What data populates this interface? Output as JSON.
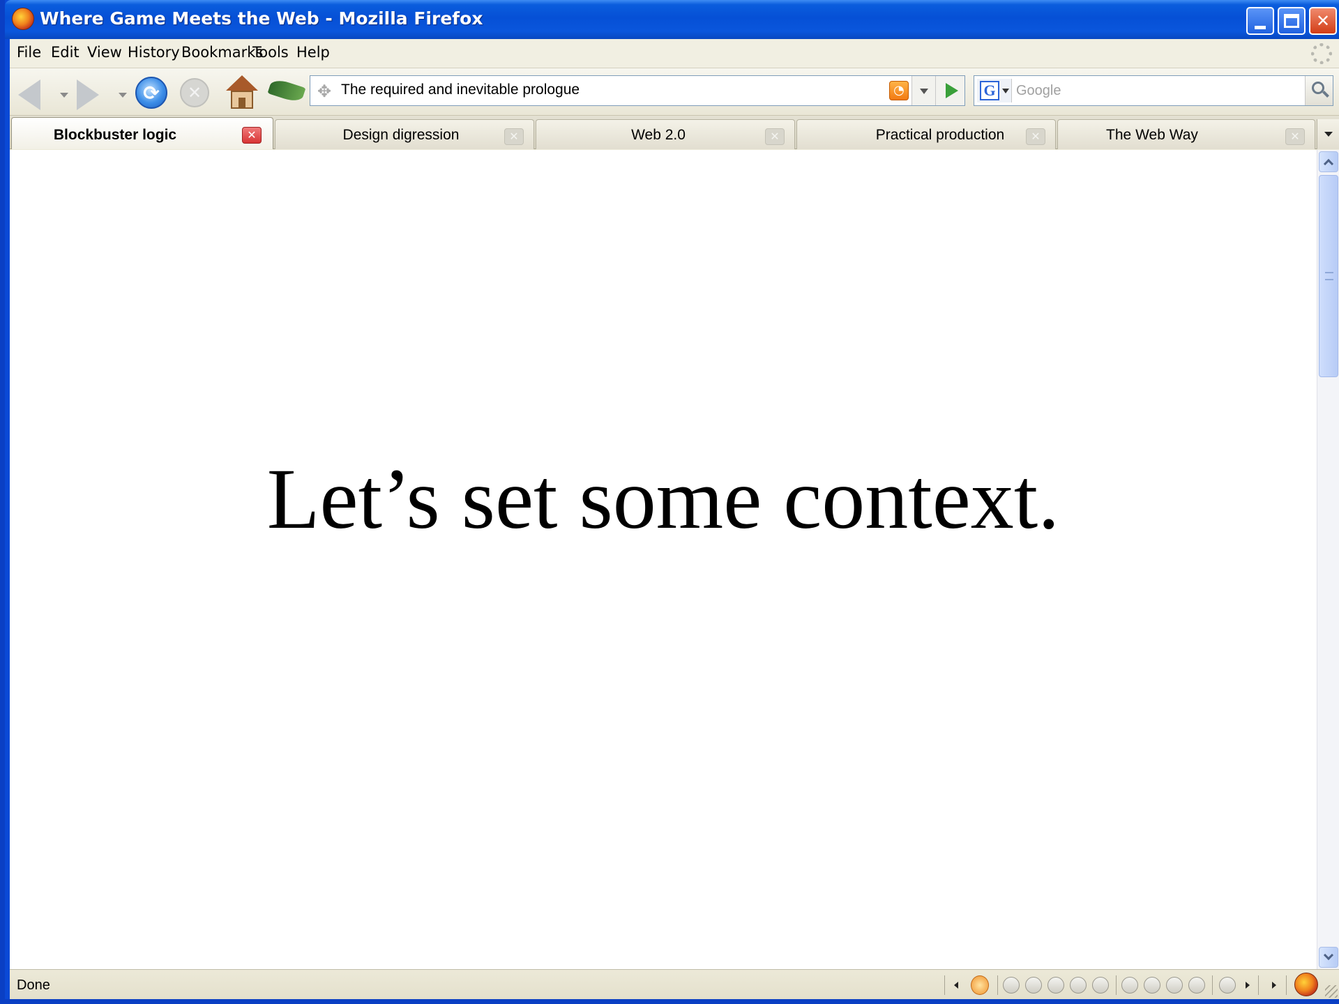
{
  "window": {
    "title": "Where Game Meets the Web - Mozilla Firefox"
  },
  "menu": {
    "items": [
      {
        "label": "File"
      },
      {
        "label": "Edit"
      },
      {
        "label": "View"
      },
      {
        "label": "History"
      },
      {
        "label": "Bookmarks"
      },
      {
        "label": "Tools"
      },
      {
        "label": "Help"
      }
    ]
  },
  "navbar": {
    "url": "The required and inevitable prologue",
    "search_placeholder": "Google",
    "search_engine_letter": "G"
  },
  "tabs": [
    {
      "label": "Blockbuster logic",
      "active": true
    },
    {
      "label": "Design digression",
      "active": false
    },
    {
      "label": "Web 2.0",
      "active": false
    },
    {
      "label": "Practical production",
      "active": false
    },
    {
      "label": "The Web Way",
      "active": false
    }
  ],
  "content": {
    "slide_text": "Let’s set some context."
  },
  "status": {
    "text": "Done"
  },
  "colors": {
    "titlebar": "#0650d6",
    "active_tab_close": "#d83434",
    "rss": "#f27a12",
    "go_arrow": "#3aa03a"
  },
  "icons": {
    "back": "back-arrow-icon",
    "forward": "forward-arrow-icon",
    "reload": "reload-icon",
    "stop": "stop-icon",
    "home": "home-icon",
    "rss": "rss-feed-icon",
    "go": "go-arrow-icon",
    "search": "magnifier-icon",
    "firefox": "firefox-logo-icon"
  }
}
